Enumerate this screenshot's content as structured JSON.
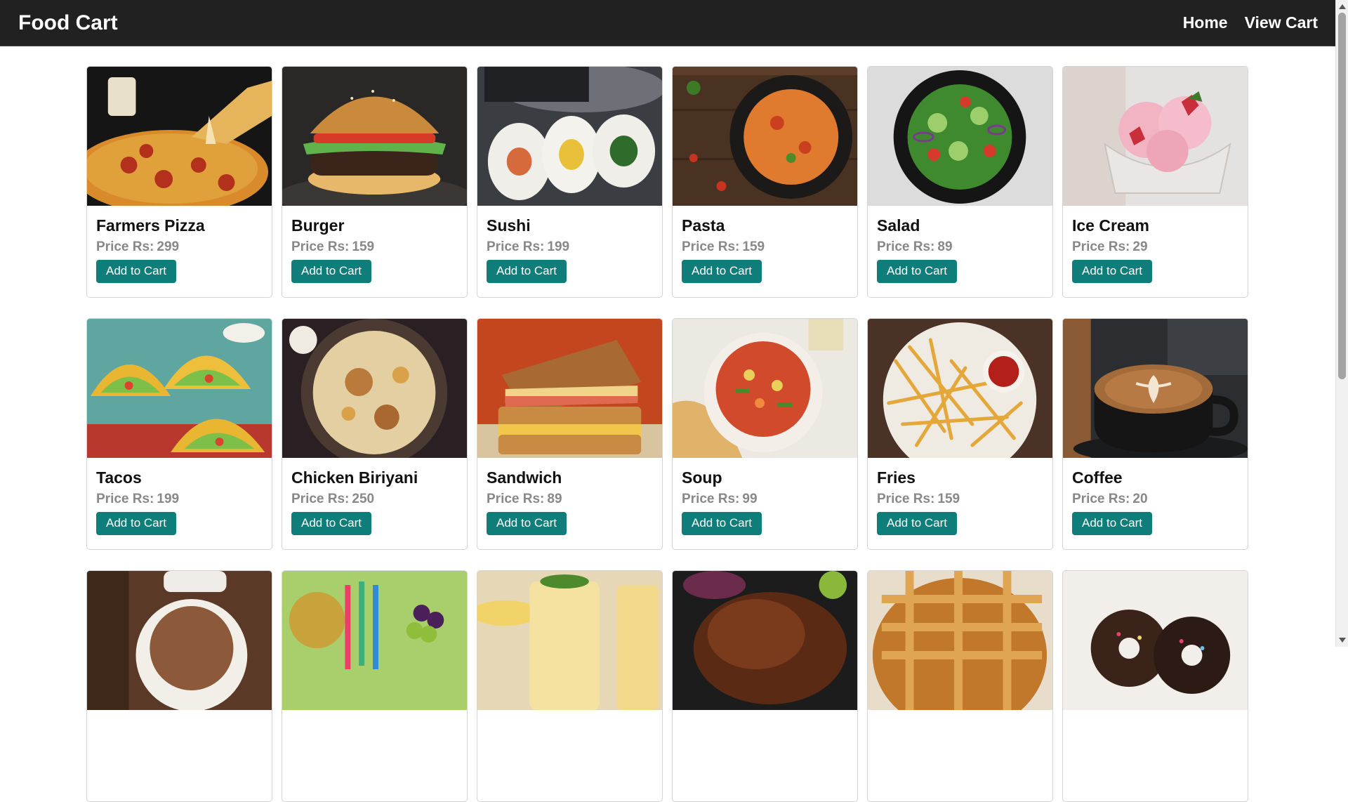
{
  "brand": "Food Cart",
  "nav": {
    "home": "Home",
    "view_cart": "View Cart"
  },
  "price_prefix": "Price Rs:",
  "add_label": "Add to Cart",
  "items": [
    {
      "name": "Farmers Pizza",
      "price": "299",
      "icon": "pizza-image"
    },
    {
      "name": "Burger",
      "price": "159",
      "icon": "burger-image"
    },
    {
      "name": "Sushi",
      "price": "199",
      "icon": "sushi-image"
    },
    {
      "name": "Pasta",
      "price": "159",
      "icon": "pasta-image"
    },
    {
      "name": "Salad",
      "price": "89",
      "icon": "salad-image"
    },
    {
      "name": "Ice Cream",
      "price": "29",
      "icon": "ice-cream-image"
    },
    {
      "name": "Tacos",
      "price": "199",
      "icon": "tacos-image"
    },
    {
      "name": "Chicken Biriyani",
      "price": "250",
      "icon": "biriyani-image"
    },
    {
      "name": "Sandwich",
      "price": "89",
      "icon": "sandwich-image"
    },
    {
      "name": "Soup",
      "price": "99",
      "icon": "soup-image"
    },
    {
      "name": "Fries",
      "price": "159",
      "icon": "fries-image"
    },
    {
      "name": "Coffee",
      "price": "20",
      "icon": "coffee-image"
    },
    {
      "name": "",
      "price": "",
      "icon": "tea-image"
    },
    {
      "name": "",
      "price": "",
      "icon": "fruit-juice-image"
    },
    {
      "name": "",
      "price": "",
      "icon": "milkshake-image"
    },
    {
      "name": "",
      "price": "",
      "icon": "grilled-chicken-image"
    },
    {
      "name": "",
      "price": "",
      "icon": "pie-image"
    },
    {
      "name": "",
      "price": "",
      "icon": "donut-image"
    }
  ]
}
